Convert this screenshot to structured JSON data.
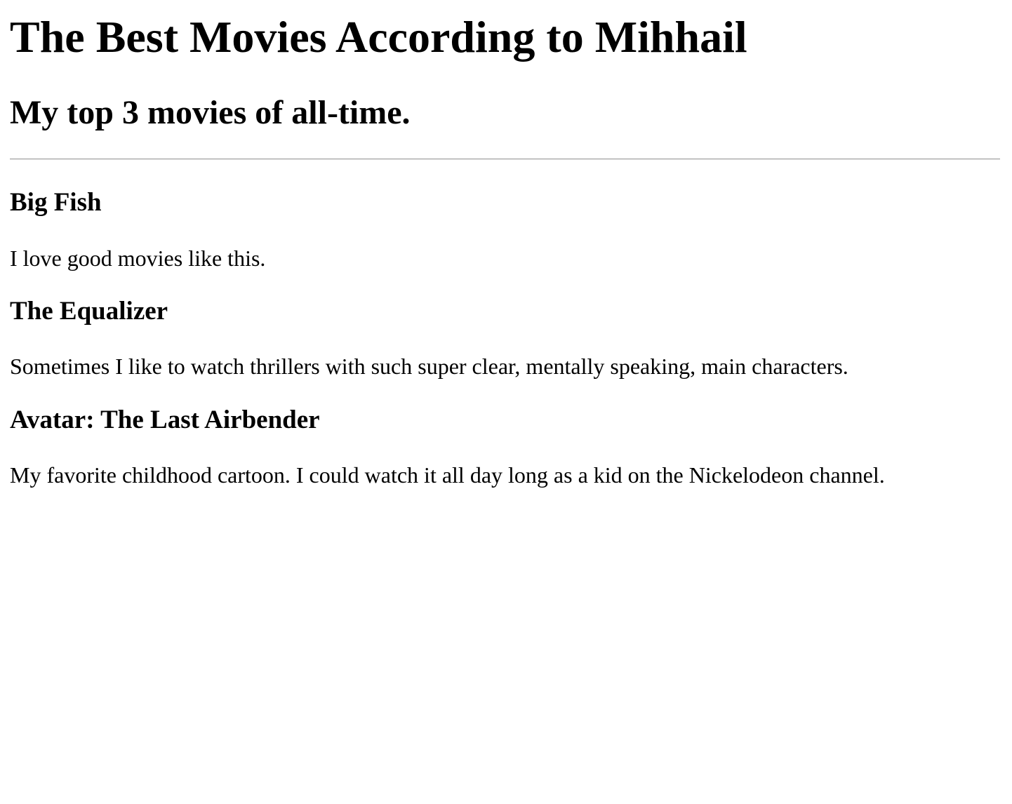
{
  "page": {
    "title": "The Best Movies According to Mihhail",
    "subtitle": "My top 3 movies of all-time."
  },
  "movies": [
    {
      "title": "Big Fish",
      "description": "I love good movies like this."
    },
    {
      "title": "The Equalizer",
      "description": "Sometimes I like to watch thrillers with such super clear, mentally speaking, main characters."
    },
    {
      "title": "Avatar: The Last Airbender",
      "description": "My favorite childhood cartoon. I could watch it all day long as a kid on the Nickelodeon channel."
    }
  ]
}
